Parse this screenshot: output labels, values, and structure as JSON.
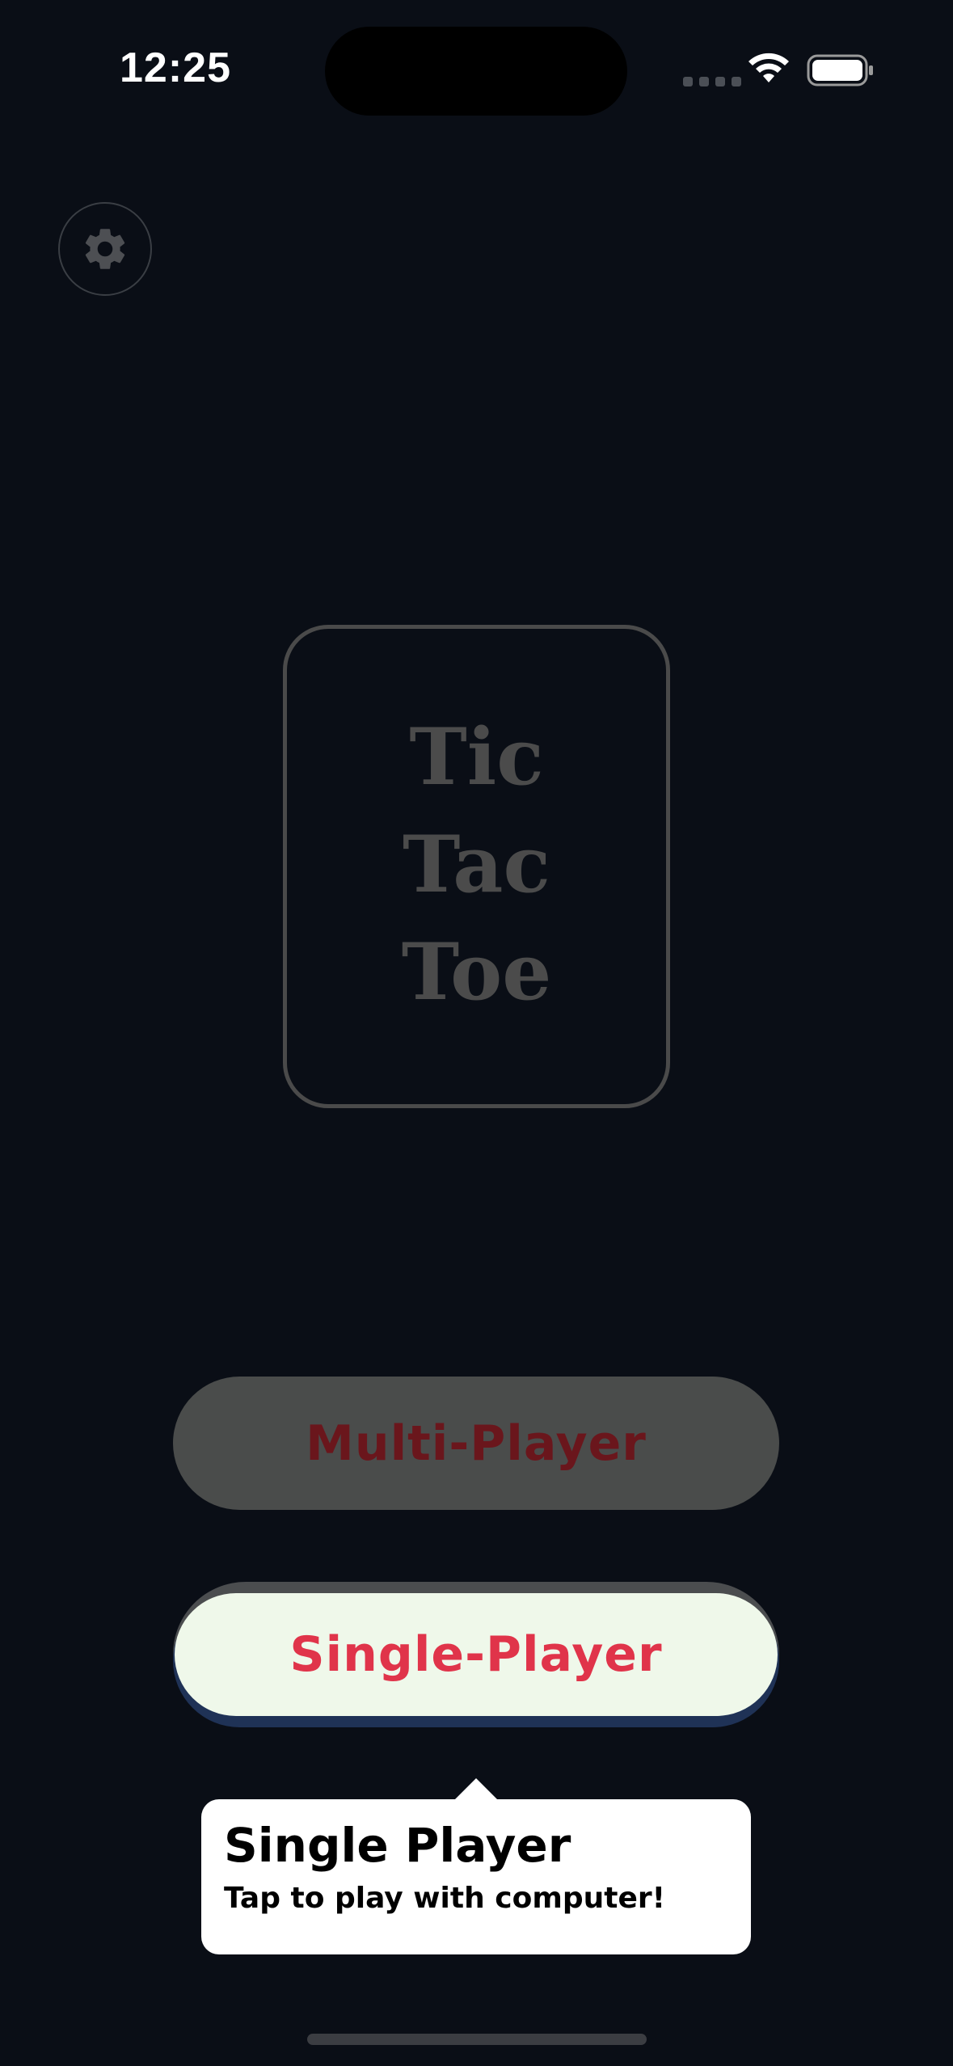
{
  "status_bar": {
    "time": "12:25"
  },
  "settings": {
    "icon": "gear-icon"
  },
  "logo": {
    "line1": "Tic",
    "line2": "Tac",
    "line3": "Toe"
  },
  "buttons": {
    "multi_player": "Multi-Player",
    "single_player": "Single-Player"
  },
  "tooltip": {
    "title": "Single Player",
    "subtitle": "Tap to play with computer!"
  },
  "colors": {
    "background": "#0a0e16",
    "multi_button_bg": "#4a4c4b",
    "multi_button_text": "#6a161c",
    "single_button_bg": "#eff8ea",
    "single_button_text": "#e0344a",
    "logo_text": "#4b4b4b"
  }
}
